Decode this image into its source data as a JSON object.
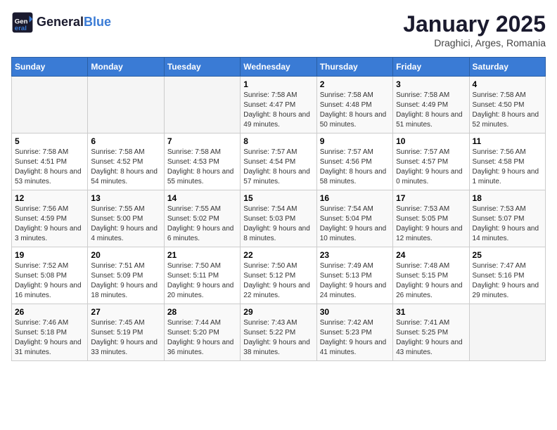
{
  "header": {
    "logo_line1": "General",
    "logo_line2": "Blue",
    "month": "January 2025",
    "location": "Draghici, Arges, Romania"
  },
  "weekdays": [
    "Sunday",
    "Monday",
    "Tuesday",
    "Wednesday",
    "Thursday",
    "Friday",
    "Saturday"
  ],
  "weeks": [
    [
      {
        "day": "",
        "info": ""
      },
      {
        "day": "",
        "info": ""
      },
      {
        "day": "",
        "info": ""
      },
      {
        "day": "1",
        "info": "Sunrise: 7:58 AM\nSunset: 4:47 PM\nDaylight: 8 hours\nand 49 minutes."
      },
      {
        "day": "2",
        "info": "Sunrise: 7:58 AM\nSunset: 4:48 PM\nDaylight: 8 hours\nand 50 minutes."
      },
      {
        "day": "3",
        "info": "Sunrise: 7:58 AM\nSunset: 4:49 PM\nDaylight: 8 hours\nand 51 minutes."
      },
      {
        "day": "4",
        "info": "Sunrise: 7:58 AM\nSunset: 4:50 PM\nDaylight: 8 hours\nand 52 minutes."
      }
    ],
    [
      {
        "day": "5",
        "info": "Sunrise: 7:58 AM\nSunset: 4:51 PM\nDaylight: 8 hours\nand 53 minutes."
      },
      {
        "day": "6",
        "info": "Sunrise: 7:58 AM\nSunset: 4:52 PM\nDaylight: 8 hours\nand 54 minutes."
      },
      {
        "day": "7",
        "info": "Sunrise: 7:58 AM\nSunset: 4:53 PM\nDaylight: 8 hours\nand 55 minutes."
      },
      {
        "day": "8",
        "info": "Sunrise: 7:57 AM\nSunset: 4:54 PM\nDaylight: 8 hours\nand 57 minutes."
      },
      {
        "day": "9",
        "info": "Sunrise: 7:57 AM\nSunset: 4:56 PM\nDaylight: 8 hours\nand 58 minutes."
      },
      {
        "day": "10",
        "info": "Sunrise: 7:57 AM\nSunset: 4:57 PM\nDaylight: 9 hours\nand 0 minutes."
      },
      {
        "day": "11",
        "info": "Sunrise: 7:56 AM\nSunset: 4:58 PM\nDaylight: 9 hours\nand 1 minute."
      }
    ],
    [
      {
        "day": "12",
        "info": "Sunrise: 7:56 AM\nSunset: 4:59 PM\nDaylight: 9 hours\nand 3 minutes."
      },
      {
        "day": "13",
        "info": "Sunrise: 7:55 AM\nSunset: 5:00 PM\nDaylight: 9 hours\nand 4 minutes."
      },
      {
        "day": "14",
        "info": "Sunrise: 7:55 AM\nSunset: 5:02 PM\nDaylight: 9 hours\nand 6 minutes."
      },
      {
        "day": "15",
        "info": "Sunrise: 7:54 AM\nSunset: 5:03 PM\nDaylight: 9 hours\nand 8 minutes."
      },
      {
        "day": "16",
        "info": "Sunrise: 7:54 AM\nSunset: 5:04 PM\nDaylight: 9 hours\nand 10 minutes."
      },
      {
        "day": "17",
        "info": "Sunrise: 7:53 AM\nSunset: 5:05 PM\nDaylight: 9 hours\nand 12 minutes."
      },
      {
        "day": "18",
        "info": "Sunrise: 7:53 AM\nSunset: 5:07 PM\nDaylight: 9 hours\nand 14 minutes."
      }
    ],
    [
      {
        "day": "19",
        "info": "Sunrise: 7:52 AM\nSunset: 5:08 PM\nDaylight: 9 hours\nand 16 minutes."
      },
      {
        "day": "20",
        "info": "Sunrise: 7:51 AM\nSunset: 5:09 PM\nDaylight: 9 hours\nand 18 minutes."
      },
      {
        "day": "21",
        "info": "Sunrise: 7:50 AM\nSunset: 5:11 PM\nDaylight: 9 hours\nand 20 minutes."
      },
      {
        "day": "22",
        "info": "Sunrise: 7:50 AM\nSunset: 5:12 PM\nDaylight: 9 hours\nand 22 minutes."
      },
      {
        "day": "23",
        "info": "Sunrise: 7:49 AM\nSunset: 5:13 PM\nDaylight: 9 hours\nand 24 minutes."
      },
      {
        "day": "24",
        "info": "Sunrise: 7:48 AM\nSunset: 5:15 PM\nDaylight: 9 hours\nand 26 minutes."
      },
      {
        "day": "25",
        "info": "Sunrise: 7:47 AM\nSunset: 5:16 PM\nDaylight: 9 hours\nand 29 minutes."
      }
    ],
    [
      {
        "day": "26",
        "info": "Sunrise: 7:46 AM\nSunset: 5:18 PM\nDaylight: 9 hours\nand 31 minutes."
      },
      {
        "day": "27",
        "info": "Sunrise: 7:45 AM\nSunset: 5:19 PM\nDaylight: 9 hours\nand 33 minutes."
      },
      {
        "day": "28",
        "info": "Sunrise: 7:44 AM\nSunset: 5:20 PM\nDaylight: 9 hours\nand 36 minutes."
      },
      {
        "day": "29",
        "info": "Sunrise: 7:43 AM\nSunset: 5:22 PM\nDaylight: 9 hours\nand 38 minutes."
      },
      {
        "day": "30",
        "info": "Sunrise: 7:42 AM\nSunset: 5:23 PM\nDaylight: 9 hours\nand 41 minutes."
      },
      {
        "day": "31",
        "info": "Sunrise: 7:41 AM\nSunset: 5:25 PM\nDaylight: 9 hours\nand 43 minutes."
      },
      {
        "day": "",
        "info": ""
      }
    ]
  ]
}
